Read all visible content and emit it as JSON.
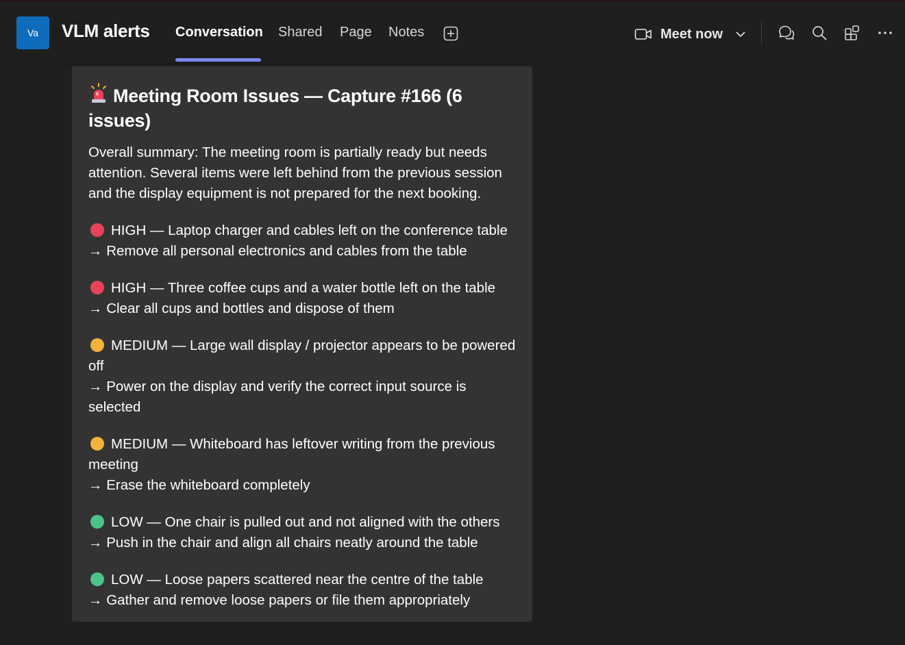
{
  "header": {
    "avatar_initials": "Va",
    "channel_title": "VLM alerts",
    "tabs": [
      {
        "label": "Conversation",
        "active": true
      },
      {
        "label": "Shared",
        "active": false
      },
      {
        "label": "Page",
        "active": false
      },
      {
        "label": "Notes",
        "active": false
      }
    ],
    "meet_now_label": "Meet now",
    "accent_color": "#7f85f5",
    "avatar_color": "#0f6cbd"
  },
  "card": {
    "title": "Meeting Room Issues — Capture #166 (6 issues)",
    "title_icon": "siren-icon",
    "summary": "Overall summary: The meeting room is partially ready but needs attention. Several items were left behind from the previous session and the display equipment is not prepared for the next booking.",
    "issues": [
      {
        "severity": "HIGH",
        "color": "#e8435a",
        "description": "HIGH — Laptop charger and cables left on the conference table",
        "action": "→ Remove all personal electronics and cables from the table"
      },
      {
        "severity": "HIGH",
        "color": "#e8435a",
        "description": "HIGH — Three coffee cups and a water bottle left on the table",
        "action": "→ Clear all cups and bottles and dispose of them"
      },
      {
        "severity": "MEDIUM",
        "color": "#f2b33d",
        "description": "MEDIUM — Large wall display / projector appears to be powered off",
        "action": "→ Power on the display and verify the correct input source is selected"
      },
      {
        "severity": "MEDIUM",
        "color": "#f2b33d",
        "description": "MEDIUM — Whiteboard has leftover writing from the previous meeting",
        "action": "→ Erase the whiteboard completely"
      },
      {
        "severity": "LOW",
        "color": "#4cc38a",
        "description": "LOW — One chair is pulled out and not aligned with the others",
        "action": "→ Push in the chair and align all chairs neatly around the table"
      },
      {
        "severity": "LOW",
        "color": "#4cc38a",
        "description": "LOW — Loose papers scattered near the centre of the table",
        "action": "→ Gather and remove loose papers or file them appropriately"
      }
    ]
  }
}
